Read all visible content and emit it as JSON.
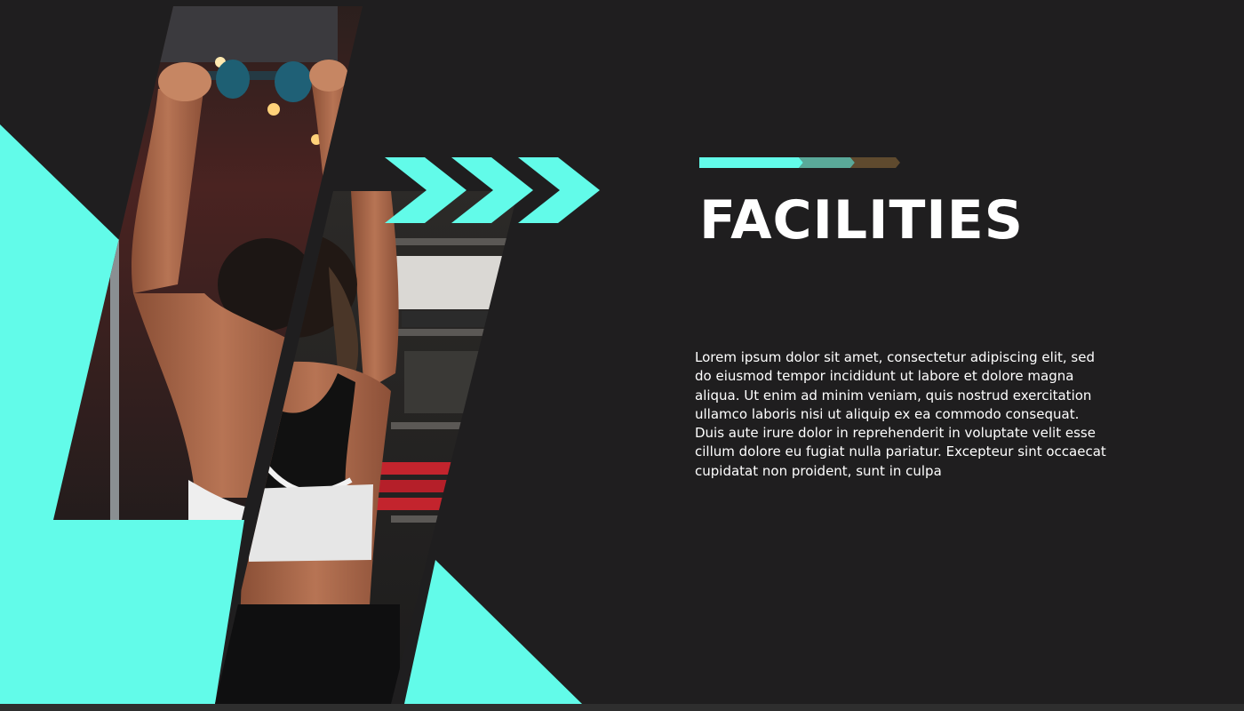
{
  "slide": {
    "title": "FACILITIES",
    "body": "Lorem ipsum dolor sit amet, consectetur adipiscing elit, sed do eiusmod tempor incididunt ut labore et dolore magna aliqua. Ut enim ad minim veniam, quis nostrud exercitation ullamco laboris nisi ut aliquip ex ea commodo consequat. Duis aute irure dolor in reprehenderit in voluptate velit esse cillum dolore eu fugiat nulla pariatur. Excepteur sint occaecat cupidatat non proident, sunt in culpa"
  },
  "colors": {
    "background": "#1f1e1f",
    "accent": "#62fbe9",
    "accent_mid": "#5aa999",
    "accent_dark": "#5f4a2e",
    "text": "#ffffff"
  },
  "icons": [
    "chevron-right-icon",
    "chevron-right-icon",
    "chevron-right-icon"
  ]
}
